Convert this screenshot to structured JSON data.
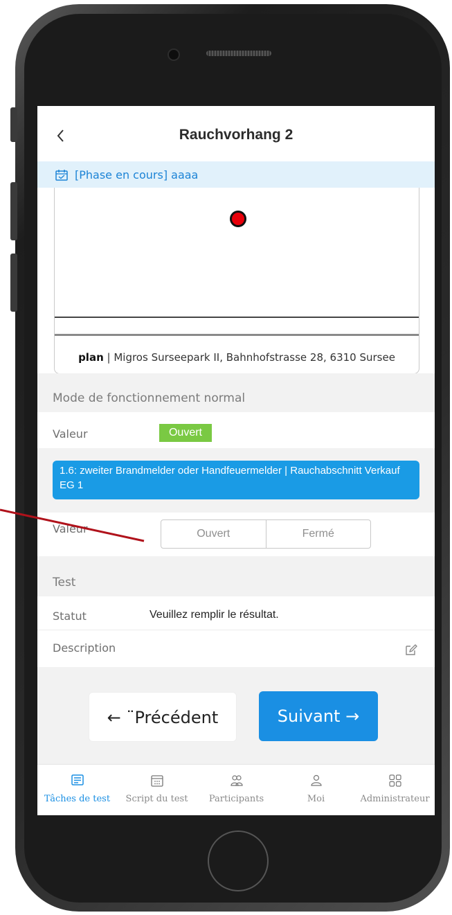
{
  "header": {
    "title": "Rauchvorhang 2"
  },
  "phase": {
    "text": "[Phase en cours] aaaa"
  },
  "plan": {
    "caption_bold": "plan",
    "caption_text": " | Migros Surseepark II, Bahnhofstrasse 28, 6310 Sursee"
  },
  "normal_mode": {
    "title": "Mode de fonctionnement normal",
    "value_label": "Valeur",
    "value": "Ouvert",
    "value_color": "#7ac943"
  },
  "step": {
    "text": "1.6: zweiter Brandmelder oder Handfeuermelder | Rauchabschnitt Verkauf EG 1",
    "value_label": "Valeur",
    "options": [
      "Ouvert",
      "Fermé"
    ]
  },
  "test": {
    "title": "Test",
    "status_label": "Statut",
    "status_value": "Veuillez remplir le résultat.",
    "description_label": "Description"
  },
  "buttons": {
    "prev": "← ¨Précédent",
    "next": "Suivant →"
  },
  "tabs": [
    {
      "label": "Tâches de test",
      "icon": "list-icon",
      "active": true
    },
    {
      "label": "Script du test",
      "icon": "calendar-icon",
      "active": false
    },
    {
      "label": "Participants",
      "icon": "users-icon",
      "active": false
    },
    {
      "label": "Moi",
      "icon": "user-icon",
      "active": false
    },
    {
      "label": "Administrateur",
      "icon": "grid-icon",
      "active": false
    }
  ],
  "colors": {
    "accent": "#1a8fe3",
    "phase_bg": "#e1f1fb",
    "step_bg": "#1a9be5",
    "annotation": "#b0121b"
  }
}
